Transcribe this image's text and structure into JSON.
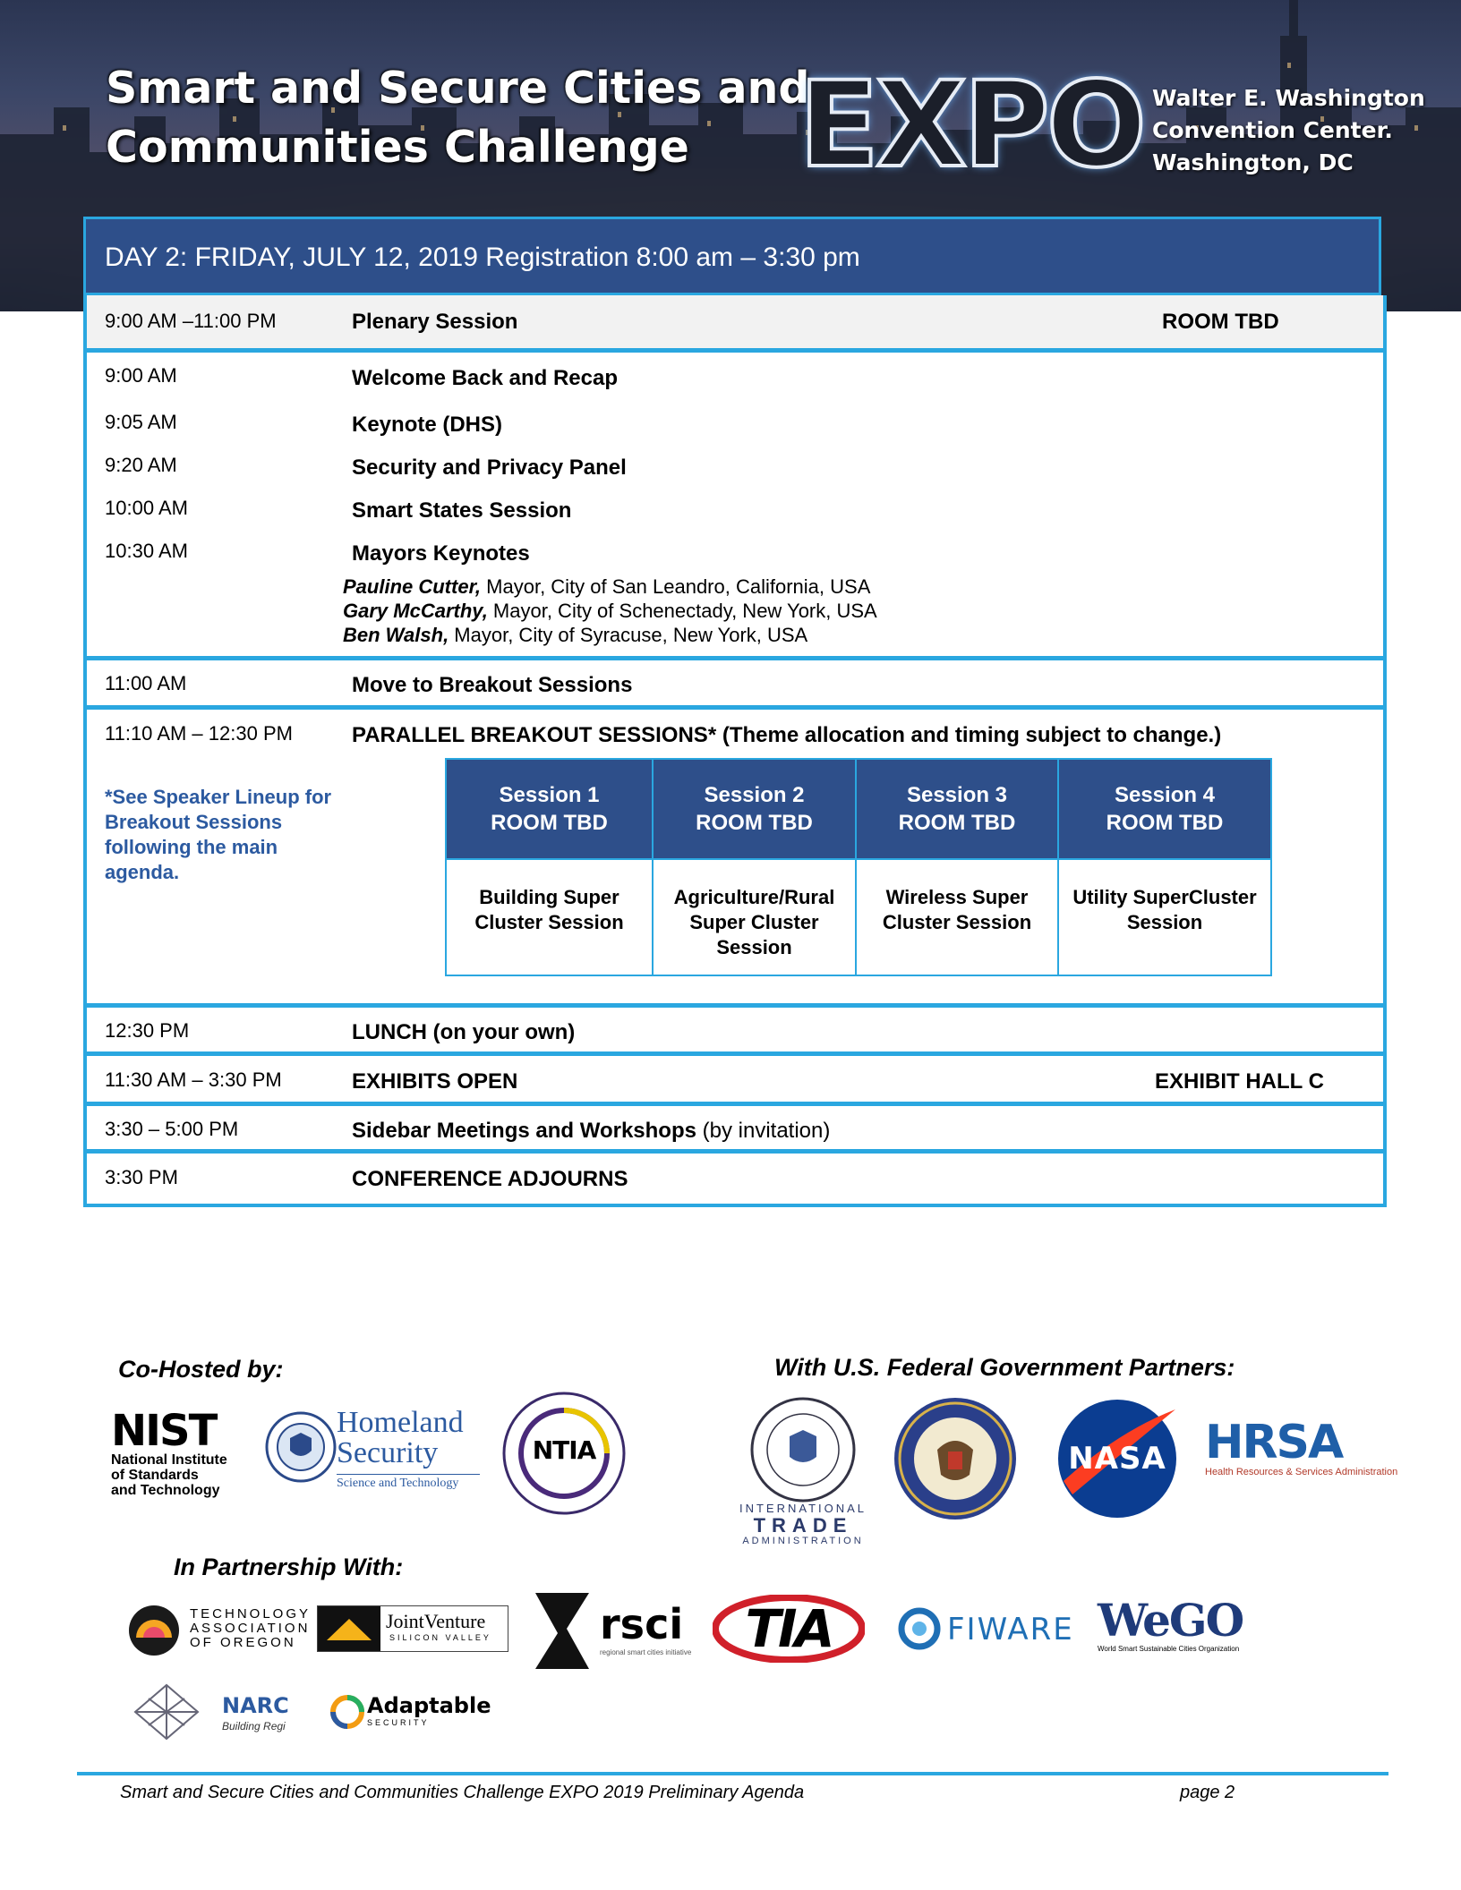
{
  "header": {
    "title_line1": "Smart and Secure Cities and",
    "title_line2": "Communities Challenge",
    "expo": "EXPO",
    "venue_line1": "Walter E. Washington",
    "venue_line2": "Convention Center.",
    "venue_line3": "Washington, DC"
  },
  "day": {
    "heading": "DAY 2: FRIDAY, JULY 12, 2019 Registration 8:00 am – 3:30 pm"
  },
  "agenda": {
    "plenary": {
      "time": "9:00 AM –11:00 PM",
      "title": "Plenary Session",
      "room": "ROOM TBD"
    },
    "items": [
      {
        "time": "9:00 AM",
        "title": "Welcome Back and Recap"
      },
      {
        "time": "9:05 AM",
        "title": "Keynote (DHS)"
      },
      {
        "time": "9:20 AM",
        "title": "Security and Privacy Panel"
      },
      {
        "time": "10:00 AM",
        "title": "Smart States Session"
      },
      {
        "time": "10:30 AM",
        "title": "Mayors Keynotes"
      }
    ],
    "speakers": [
      {
        "name": "Pauline Cutter",
        "sep": ",",
        "role": " Mayor, City of San Leandro, California, USA"
      },
      {
        "name": "Gary McCarthy",
        "sep": ",",
        "role": " Mayor, City of Schenectady, New York, USA"
      },
      {
        "name": "Ben Walsh,",
        "sep": "",
        "role": " Mayor, City of Syracuse, New York, USA"
      }
    ],
    "move": {
      "time": "11:00 AM",
      "title": "Move to Breakout Sessions"
    },
    "breakout": {
      "time": "11:10 AM – 12:30 PM",
      "title": "PARALLEL BREAKOUT SESSIONS* (Theme allocation and timing subject to change.)",
      "note": "*See Speaker Lineup for Breakout Sessions following the main agenda.",
      "sessions": [
        {
          "name": "Session 1",
          "room": "ROOM TBD",
          "topic": "Building Super Cluster Session"
        },
        {
          "name": "Session 2",
          "room": "ROOM TBD",
          "topic": "Agriculture/Rural Super Cluster Session"
        },
        {
          "name": "Session 3",
          "room": "ROOM TBD",
          "topic": "Wireless Super Cluster Session"
        },
        {
          "name": "Session 4",
          "room": "ROOM TBD",
          "topic": "Utility SuperCluster Session"
        }
      ]
    },
    "lunch": {
      "time": "12:30 PM",
      "title": "LUNCH (on your own)"
    },
    "exhibits": {
      "time": "11:30 AM – 3:30 PM",
      "title": "EXHIBITS OPEN",
      "room": "EXHIBIT HALL C"
    },
    "sidebar": {
      "time": "3:30 – 5:00 PM",
      "title": "Sidebar Meetings and Workshops",
      "suffix": " (by invitation)"
    },
    "adjourn": {
      "time": "3:30 PM",
      "title": "CONFERENCE ADJOURNS"
    }
  },
  "sponsors": {
    "cohosted_label": "Co-Hosted by:",
    "federal_label": "With U.S. Federal Government Partners:",
    "partnership_label": "In Partnership With:",
    "nist": {
      "mark": "NIST",
      "line1": "National Institute",
      "line2": "of Standards",
      "line3": "and Technology"
    },
    "dhs": {
      "line1": "Homeland",
      "line2": "Security",
      "line3": "Science and Technology"
    },
    "ntia": {
      "mark": "NTIA"
    },
    "ita": {
      "line1": "INTERNATIONAL",
      "line2": "TRADE",
      "line3": "ADMINISTRATION"
    },
    "nasa": {
      "mark": "NASA"
    },
    "hrsa": {
      "mark": "HRSA",
      "tagline": "Health Resources & Services Administration"
    },
    "tao": {
      "line1": "TECHNOLOGY",
      "line2": "ASSOCIATION",
      "line3": "OF OREGON"
    },
    "jv": {
      "line1": "JointVenture",
      "line2": "SILICON VALLEY"
    },
    "rsci": {
      "mark": "rsci",
      "tagline": "regional smart cities initiative"
    },
    "tia": {
      "mark": "TIA"
    },
    "fiware": {
      "mark": "FIWARE"
    },
    "wego": {
      "mark": "WeGO",
      "tagline": "World Smart Sustainable Cities Organization"
    },
    "narc": {
      "mark": "NARC",
      "tagline": "Building Regi"
    },
    "adaptable": {
      "mark": "Adaptable",
      "tagline": "SECURITY"
    }
  },
  "footer": {
    "left": "Smart and Secure Cities and Communities Challenge EXPO 2019 Preliminary Agenda",
    "right": "page 2"
  },
  "colors": {
    "accent_blue": "#2aa7e0",
    "header_navy": "#2e4f8a",
    "note_blue": "#2c5aa0"
  }
}
